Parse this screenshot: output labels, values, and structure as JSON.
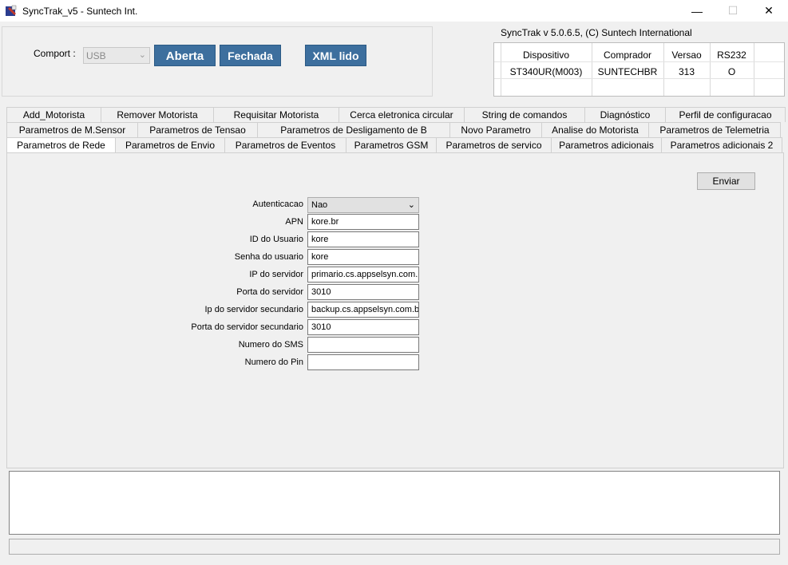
{
  "window": {
    "title": "SyncTrak_v5 - Suntech Int.",
    "minimize": "—",
    "maximize": "☐",
    "close": "✕"
  },
  "connection": {
    "comport_label": "Comport :",
    "comport_value": "USB",
    "open_button": "Aberta",
    "close_button": "Fechada",
    "xml_button": "XML lido"
  },
  "info": {
    "version_text": "SyncTrak v 5.0.6.5, (C) Suntech International",
    "headers": [
      "Dispositivo",
      "Comprador",
      "Versao",
      "RS232"
    ],
    "values": [
      "ST340UR(M003)",
      "SUNTECHBR",
      "313",
      "O"
    ]
  },
  "tabs": {
    "row1": [
      "Add_Motorista",
      "Remover Motorista",
      "Requisitar Motorista",
      "Cerca eletronica circular",
      "String de comandos",
      "Diagnóstico",
      "Perfil de configuracao"
    ],
    "row2": [
      "Parametros  de M.Sensor",
      "Parametros de Tensao",
      "Parametros de Desligamento de B",
      "Novo Parametro",
      "Analise do Motorista",
      "Parametros de Telemetria"
    ],
    "row3": [
      "Parametros de Rede",
      "Parametros de Envio",
      "Parametros de Eventos",
      "Parametros GSM",
      "Parametros de servico",
      "Parametros adicionais",
      "Parametros adicionais 2"
    ],
    "active": "Parametros de Rede"
  },
  "form": {
    "send_button": "Enviar",
    "auth_label": "Autenticacao",
    "auth_value": "Nao",
    "apn_label": "APN",
    "apn_value": "kore.br",
    "user_label": "ID do Usuario",
    "user_value": "kore",
    "password_label": "Senha do usuario",
    "password_value": "kore",
    "server_ip_label": "IP do servidor",
    "server_ip_value": "primario.cs.appselsyn.com.",
    "server_port_label": "Porta do servidor",
    "server_port_value": "3010",
    "server2_ip_label": "Ip do servidor secundario",
    "server2_ip_value": "backup.cs.appselsyn.com.b",
    "server2_port_label": "Porta do servidor secundario",
    "server2_port_value": "3010",
    "sms_label": "Numero do SMS",
    "sms_value": "",
    "pin_label": "Numero do Pin",
    "pin_value": ""
  },
  "log": {
    "content": ""
  },
  "status": {
    "text": ""
  }
}
